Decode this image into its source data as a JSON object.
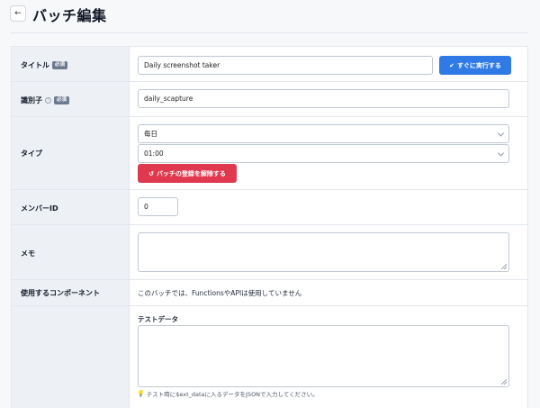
{
  "header": {
    "back_icon": "arrow-left-icon",
    "back_glyph": "←",
    "title": "バッチ編集"
  },
  "form": {
    "title_row": {
      "label": "タイトル",
      "required": "必須",
      "value": "Daily screenshot taker",
      "run_button": "すぐに実行する",
      "run_icon": "check-icon"
    },
    "identifier_row": {
      "label": "識別子",
      "help_glyph": "?",
      "required": "必須",
      "value": "daily_scapture"
    },
    "type_row": {
      "label": "タイプ",
      "frequency": "毎日",
      "time": "01:00",
      "unregister_button": "バッチの登録を解除する",
      "unregister_icon": "undo-icon"
    },
    "member_row": {
      "label": "メンバーID",
      "value": "0"
    },
    "memo_row": {
      "label": "メモ",
      "value": ""
    },
    "components_row": {
      "label": "使用するコンポーネント",
      "text": "このバッチでは、FunctionsやAPIは使用していません"
    },
    "test_data_row": {
      "heading": "テストデータ",
      "value": "",
      "hint": "テスト時に$ext_dataに入るデータをJSONで入力してください。",
      "hint_icon": "lightbulb-icon"
    }
  },
  "colors": {
    "primary": "#2f7ae5",
    "danger": "#e0394f",
    "label_bg": "#edf1f6",
    "required_badge": "#6b7a8f"
  }
}
